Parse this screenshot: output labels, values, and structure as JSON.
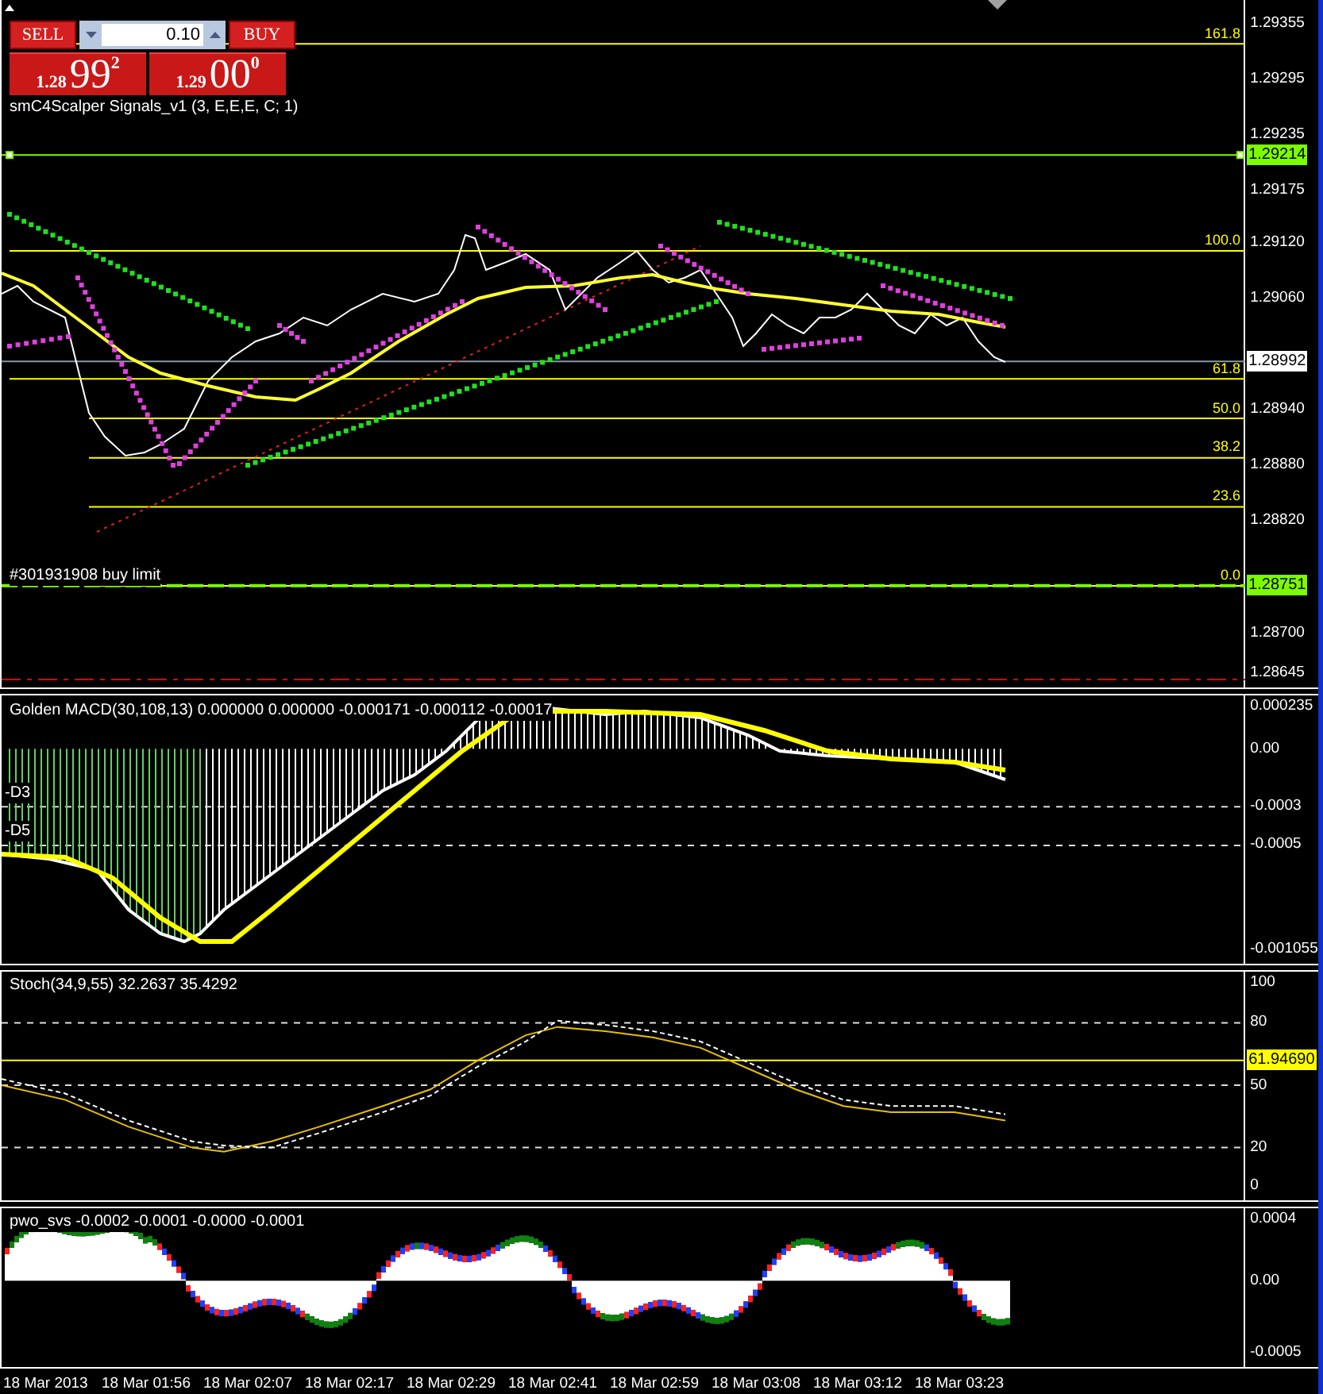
{
  "trade_panel": {
    "sell_label": "SELL",
    "lot": "0.10",
    "buy_label": "BUY",
    "bid": {
      "handle": "1.28",
      "pips": "99",
      "point": "2"
    },
    "ask": {
      "handle": "1.29",
      "pips": "00",
      "point": "0"
    }
  },
  "price_panel": {
    "title": "smC4Scalper Signals_v1 (3, E,E,E, C; 1)",
    "axis_labels": [
      "1.29355",
      "1.29295",
      "1.29235",
      "1.29175",
      "1.29120",
      "1.29060",
      "1.28940",
      "1.28880",
      "1.28820",
      "1.28700",
      "1.28645"
    ],
    "price_tags": [
      {
        "text": "1.29214",
        "color": "#7cfc00"
      },
      {
        "text": "1.28992",
        "color": "#ffffff"
      },
      {
        "text": "1.28751",
        "color": "#7cfc00"
      }
    ],
    "fib_levels": [
      "161.8",
      "100.0",
      "61.8",
      "50.0",
      "38.2",
      "23.6",
      "0.0"
    ],
    "order_label": "#301931908 buy limit"
  },
  "macd_panel": {
    "title": "Golden MACD(30,108,13) 0.000000 0.000000 -0.000171 -0.000112 -0.00017",
    "axis_labels": [
      "0.000235",
      "0.00",
      "-0.0003",
      "-0.0005",
      "-0.001055"
    ],
    "level_labels": [
      "-D3",
      "-D5"
    ]
  },
  "stoch_panel": {
    "title": "Stoch(34,9,55) 32.2637 35.4292",
    "axis_labels": [
      "100",
      "80",
      "50",
      "20",
      "0"
    ],
    "price_tags": [
      {
        "text": "61.94690",
        "color": "#ffff00"
      }
    ]
  },
  "pwo_panel": {
    "title": "pwo_svs -0.0002 -0.0001 -0.0000 -0.0001",
    "axis_labels": [
      "0.0004",
      "0.00",
      "-0.0005"
    ]
  },
  "time_axis": [
    "18 Mar 2013",
    "18 Mar 01:56",
    "18 Mar 02:07",
    "18 Mar 02:17",
    "18 Mar 02:29",
    "18 Mar 02:41",
    "18 Mar 02:59",
    "18 Mar 03:08",
    "18 Mar 03:12",
    "18 Mar 03:23"
  ]
}
